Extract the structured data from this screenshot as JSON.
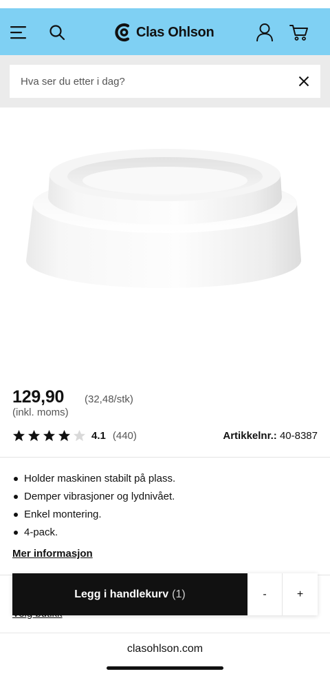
{
  "header": {
    "brand": "Clas Ohlson",
    "menu_icon": "hamburger-menu-icon",
    "search_icon": "search-icon",
    "account_icon": "user-icon",
    "cart_icon": "cart-icon",
    "background_color": "#7fd0f3"
  },
  "search": {
    "placeholder": "Hva ser du etter i dag?",
    "value": "",
    "clear_icon": "close-icon"
  },
  "product": {
    "price": "129,90",
    "unit_price": "(32,48/stk)",
    "price_note": "(inkl. moms)",
    "rating": {
      "value": "4.1",
      "stars_filled": 4.1,
      "stars_total": 5,
      "count": "(440)"
    },
    "article_label": "Artikkelnr.:",
    "article_number": "40-8387",
    "features": [
      "Holder maskinen stabilt på plass.",
      "Demper vibrasjoner og lydnivået.",
      "Enkel montering.",
      "4-pack."
    ],
    "more_info": "Mer informasjon",
    "store_link": "Velg butikk"
  },
  "cart": {
    "button_label": "Legg i handlekurv",
    "count": "(1)",
    "minus": "-",
    "plus": "+"
  },
  "browser": {
    "url": "clasohlson.com"
  }
}
